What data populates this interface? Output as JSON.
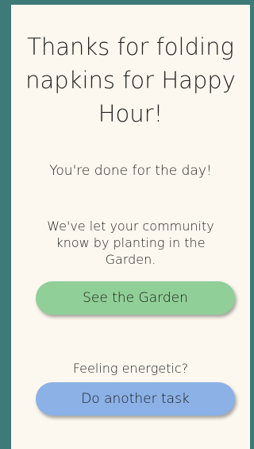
{
  "colors": {
    "background": "#3d7a78",
    "panel": "#fdf8ef",
    "garden_button": "#90cf97",
    "task_button": "#8bb1e6"
  },
  "header": {
    "title": "Thanks for folding napkins for Happy Hour!"
  },
  "status": {
    "done_message": "You're done for the day!",
    "community_message": "We've let your community know by planting in the Garden."
  },
  "actions": {
    "see_garden_label": "See the Garden",
    "prompt": "Feeling energetic?",
    "another_task_label": "Do another task"
  }
}
